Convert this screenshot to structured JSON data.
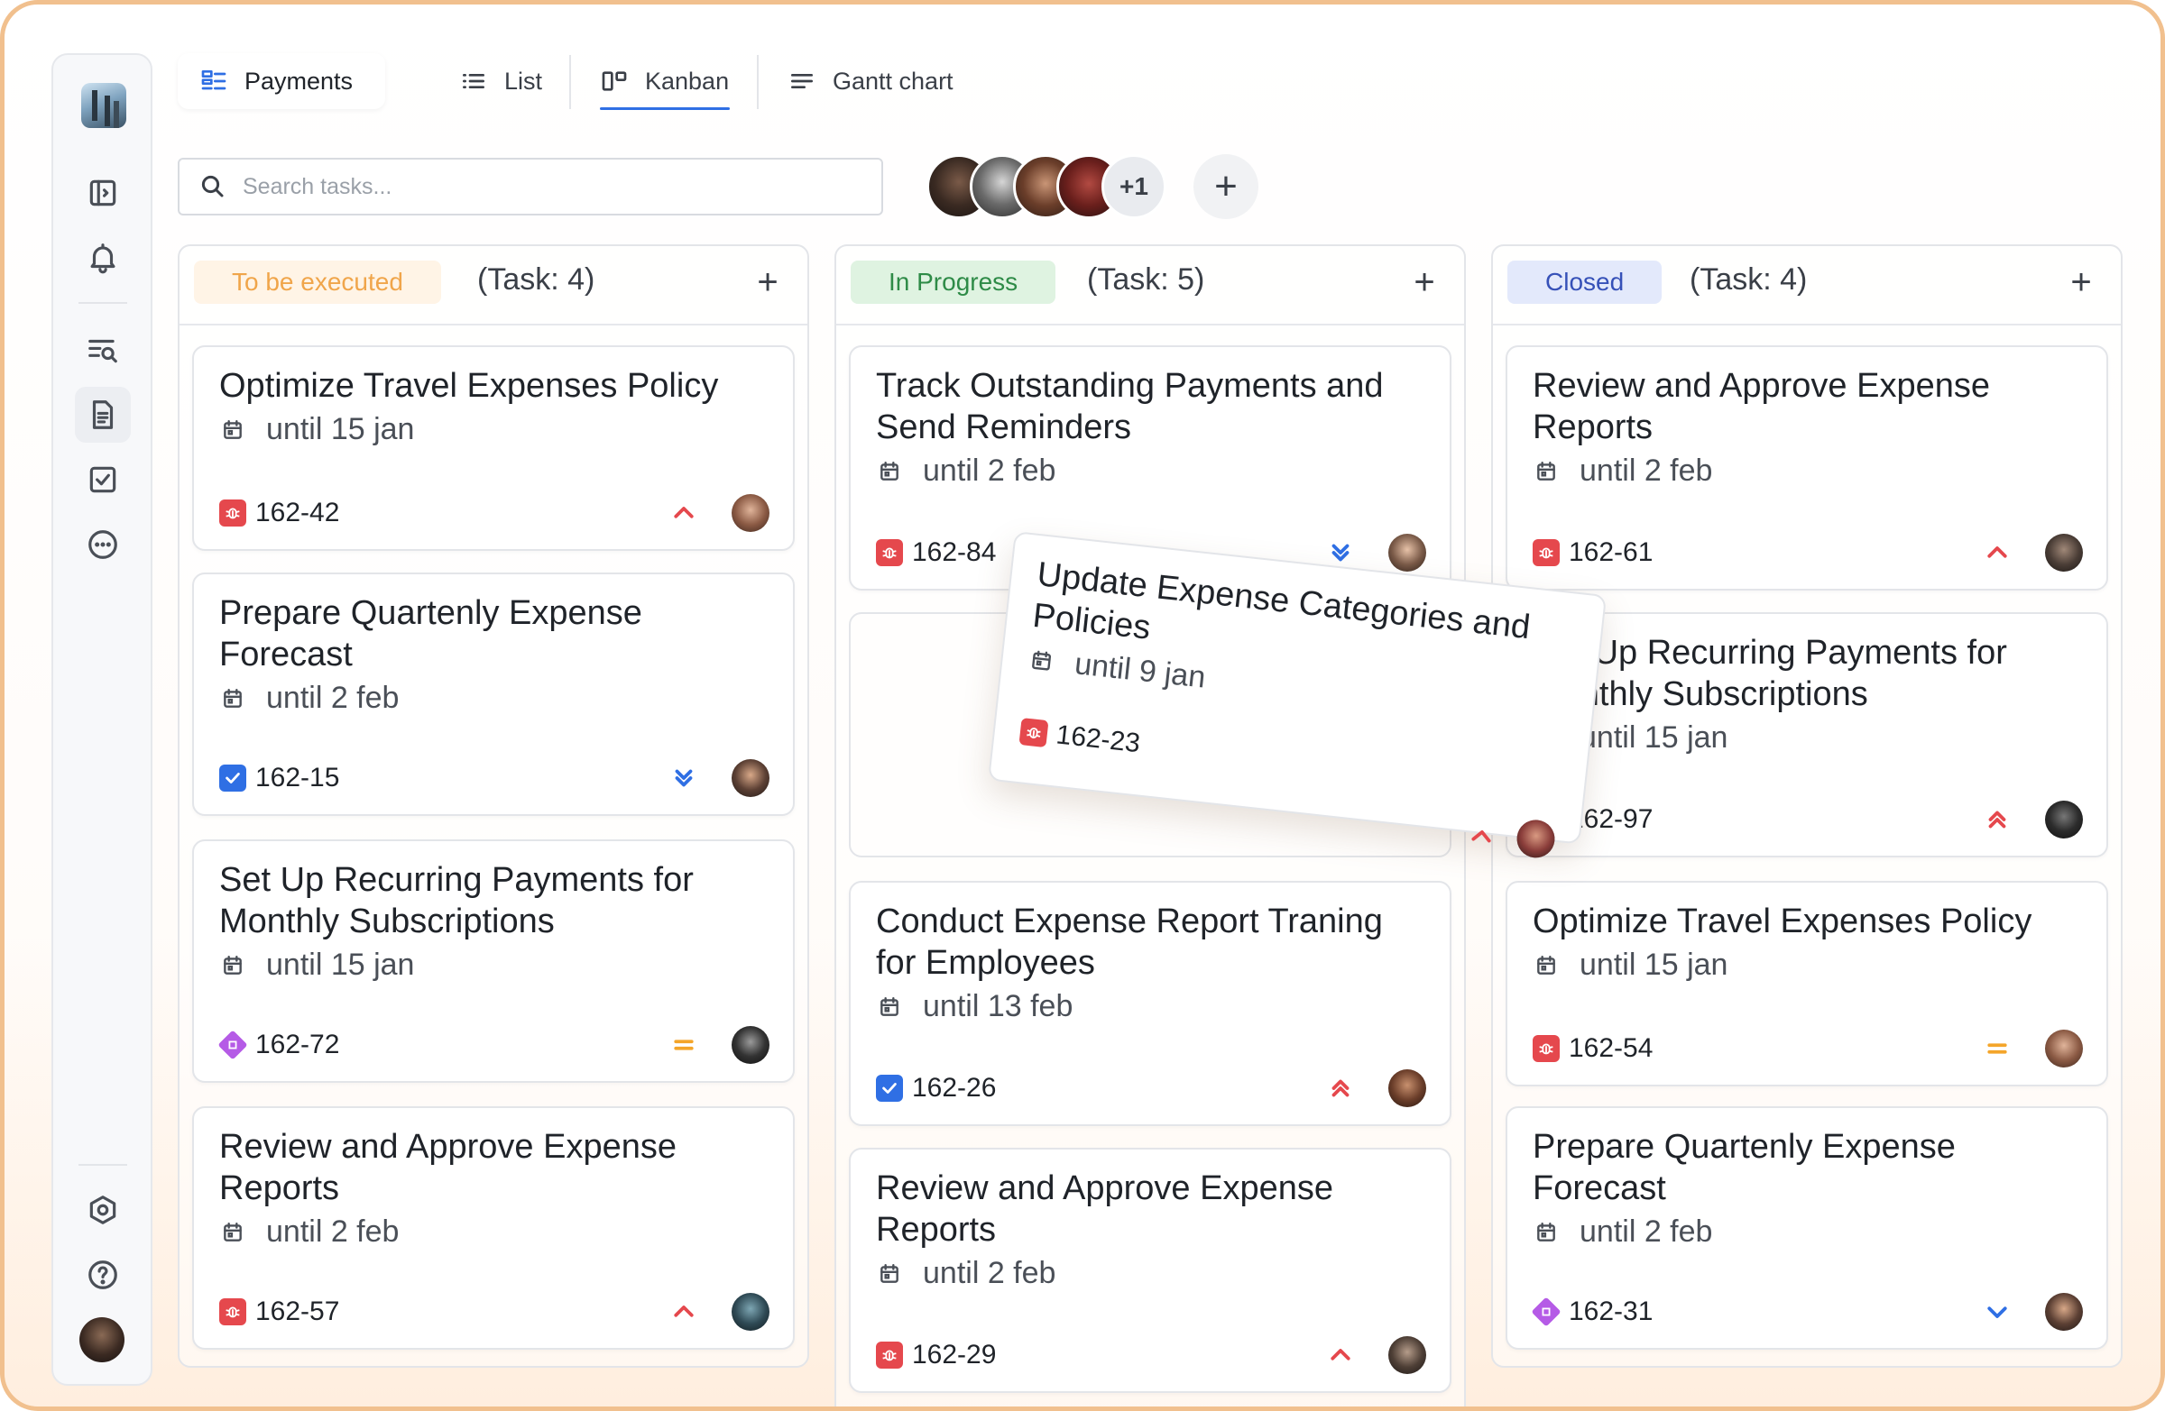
{
  "tabs": {
    "payments": "Payments",
    "list": "List",
    "kanban": "Kanban",
    "gantt": "Gantt chart"
  },
  "search": {
    "placeholder": "Search tasks..."
  },
  "members": {
    "more": "+1",
    "add": "+"
  },
  "colors": {
    "accent": "#2f6fe4",
    "todo_bg": "#fff4e6",
    "todo_fg": "#f0a54a",
    "progress_bg": "#dff3e1",
    "progress_fg": "#2e8b47",
    "closed_bg": "#e3e9fb",
    "closed_fg": "#3651b8",
    "priority_high": "#e5484d",
    "priority_low": "#2f6fe4",
    "priority_medium": "#f4a52a"
  },
  "columns": [
    {
      "status": "To be executed",
      "count": "(Task: 4)",
      "add": "+",
      "cards": [
        {
          "title": "Optimize Travel Expenses Policy",
          "due": "until 15 jan",
          "key": "162-42",
          "type": "bug-icon",
          "priority": "high"
        },
        {
          "title": "Prepare Quartenly Expense Forecast",
          "due": "until 2 feb",
          "key": "162-15",
          "type": "task-icon",
          "priority": "lowest"
        },
        {
          "title": "Set Up Recurring Payments for Monthly Subscriptions",
          "due": "until 15 jan",
          "key": "162-72",
          "type": "story-icon",
          "priority": "medium"
        },
        {
          "title": "Review and Approve Expense Reports",
          "due": "until 2 feb",
          "key": "162-57",
          "type": "bug-icon",
          "priority": "high"
        }
      ]
    },
    {
      "status": "In Progress",
      "count": "(Task: 5)",
      "add": "+",
      "cards": [
        {
          "title": "Track Outstanding Payments and Send Reminders",
          "due": "until 2 feb",
          "key": "162-84",
          "type": "bug-icon",
          "priority": "lowest"
        },
        {
          "title": "Conduct Expense Report Traning for Employees",
          "due": "until 13 feb",
          "key": "162-26",
          "type": "task-icon",
          "priority": "highest"
        },
        {
          "title": "Review and Approve Expense Reports",
          "due": "until 2 feb",
          "key": "162-29",
          "type": "bug-icon",
          "priority": "high"
        }
      ]
    },
    {
      "status": "Closed",
      "count": "(Task: 4)",
      "add": "+",
      "cards": [
        {
          "title": "Review and Approve Expense Reports",
          "due": "until 2 feb",
          "key": "162-61",
          "type": "bug-icon",
          "priority": "high"
        },
        {
          "title": "Set Up Recurring Payments for Monthly Subscriptions",
          "due": "until 15 jan",
          "key": "162-97",
          "type": "bug-icon",
          "priority": "highest"
        },
        {
          "title": "Optimize Travel Expenses Policy",
          "due": "until 15 jan",
          "key": "162-54",
          "type": "bug-icon",
          "priority": "medium"
        },
        {
          "title": "Prepare Quartenly Expense Forecast",
          "due": "until 2 feb",
          "key": "162-31",
          "type": "story-icon",
          "priority": "low"
        }
      ]
    }
  ],
  "dragged_card": {
    "title": "Update Expense Categories and Policies",
    "due": "until 9 jan",
    "key": "162-23",
    "type": "bug-icon",
    "priority": "high"
  }
}
